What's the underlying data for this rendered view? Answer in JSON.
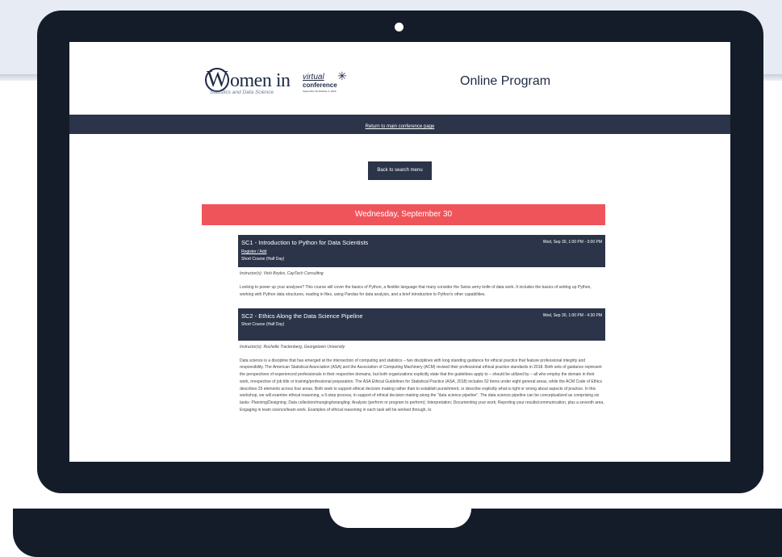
{
  "site": {
    "logo_text": "omen in",
    "logo_letter": "W",
    "logo_sub": "Statistics and Data Science",
    "logo_virtual": "virtual",
    "logo_conference": "conference",
    "logo_dates": "September 29-October 2, 2020",
    "page_title": "Online Program"
  },
  "nav": {
    "main_link": "Return to main conference page"
  },
  "back_button": "Back to search menu",
  "day_banner": "Wednesday, September 30",
  "sessions": [
    {
      "title": "SC1 - Introduction to Python for Data Scientists",
      "time": "Wed, Sep 30, 1:00 PM - 3:00 PM",
      "register": "Register / Add",
      "type": "Short Course (Half Day)",
      "instructor": "Instructor(s): Vicki Boykis, CapTech Consulting",
      "description": "Looking to power up your analyses? This course will cover the basics of Python, a flexible language that many consider the Swiss army knife of data work. It includes the basics of setting up Python, working with Python data structures, reading in files, using Pandas for data analysis, and a brief introduction to Python's other capabilities."
    },
    {
      "title": "SC2 - Ethics Along the Data Science Pipeline",
      "time": "Wed, Sep 30, 1:00 PM - 4:30 PM",
      "type": "Short Course (Half Day)",
      "instructor": "Instructor(s): Rochelle Tractenberg, Georgetown University",
      "description": "Data science is a discipline that has emerged at the intersection of computing and statistics – two disciplines with long standing guidance for ethical practice that feature professional integrity and responsibility. The American Statistical Association (ASA) and the Association of Computing Machinery (ACM) revised their professional ethical practice standards in 2018. Both sets of guidance represent the perspectives of experienced professionals in their respective domains, but both organizations explicitly state that the guidelines apply to – should be utilized by – all who employ the domain in their work, irrespective of job title or training/professional preparation. The ASA Ethical Guidelines for Statistical Practice (ASA, 2018) includes 52 items under eight general areas, while the ACM Code of Ethics describes 25 elements across four areas. Both seek to support ethical decision making rather than to establish punishment, or describe explicitly what is right or wrong about aspects of practice. In this workshop, we will examine ethical reasoning, a 6-step process, in support of ethical decision making along the \"data science pipeline\". The data science pipeline can be conceptualized as comprising six tasks: Planning/Designing; Data collection/munging/wrangling; Analysis (perform or program to perform); Interpretation; Documenting your work; Reporting your results/communication, plus a seventh area, Engaging in team science/team work. Examples of ethical reasoning in each task will be worked through, to"
    }
  ]
}
